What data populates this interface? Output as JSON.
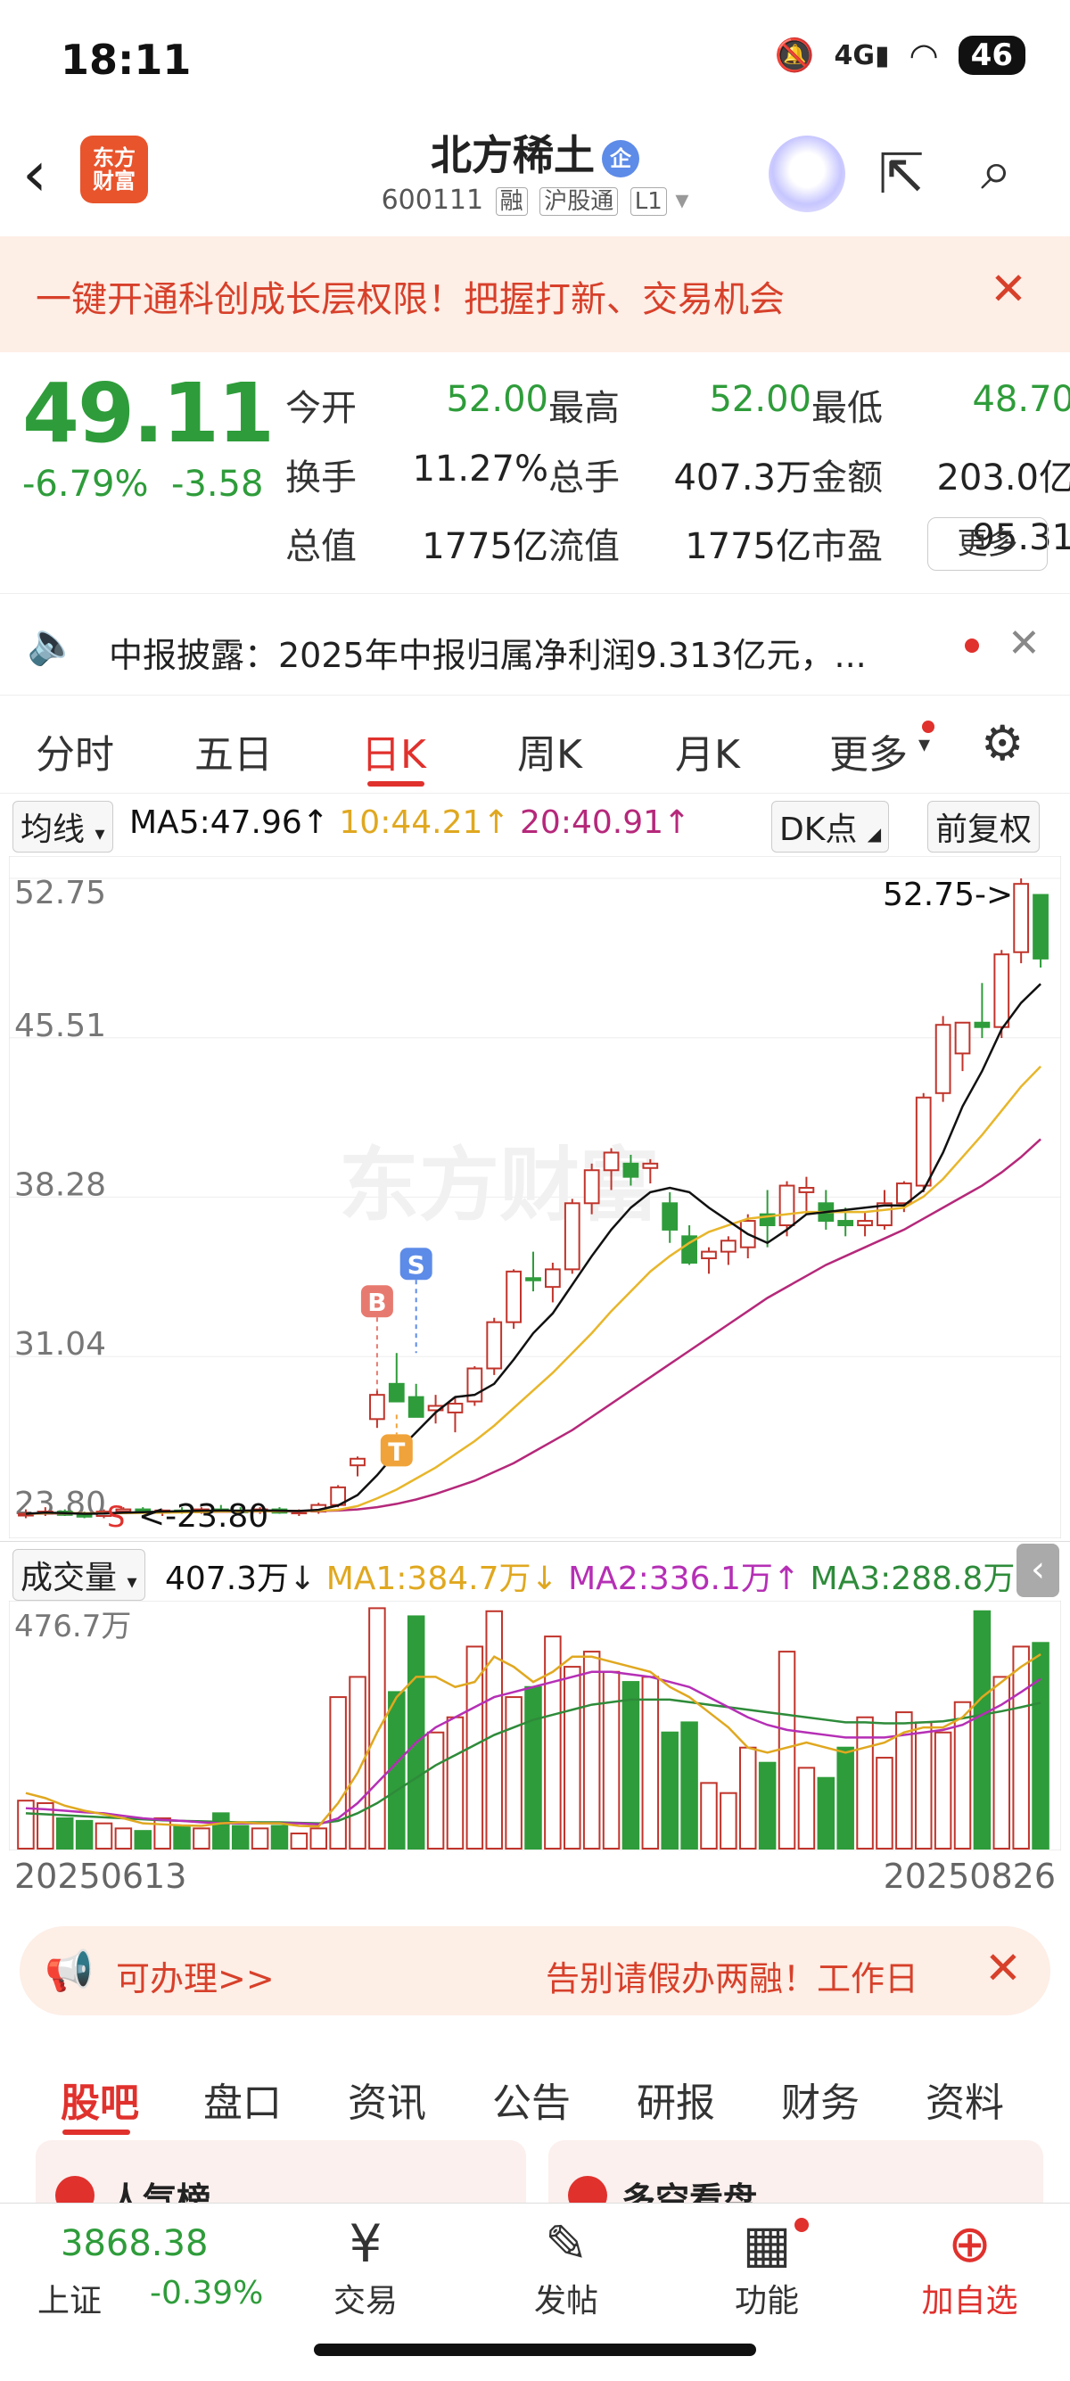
{
  "status": {
    "time": "18:11",
    "network": "4G",
    "battery": "46"
  },
  "header": {
    "logo": "东方\n财富",
    "logo_l1": "东方",
    "logo_l2": "财富",
    "name": "北方稀土",
    "name_badge": "企",
    "code": "600111",
    "tags": [
      "融",
      "沪股通",
      "L1"
    ]
  },
  "banner": {
    "text": "一键开通科创成长层权限！把握打新、交易机会"
  },
  "quote": {
    "price": "49.11",
    "pct": "-6.79%",
    "chg": "-3.58",
    "fields": [
      {
        "label": "今开",
        "value": "52.00",
        "color": "#2e9c3a"
      },
      {
        "label": "最高",
        "value": "52.00",
        "color": "#2e9c3a"
      },
      {
        "label": "最低",
        "value": "48.70",
        "color": "#2e9c3a"
      },
      {
        "label": "换手",
        "value": "11.27%",
        "color": "#222"
      },
      {
        "label": "总手",
        "value": "407.3万",
        "color": "#222"
      },
      {
        "label": "金额",
        "value": "203.0亿",
        "color": "#222"
      },
      {
        "label": "总值",
        "value": "1775亿",
        "color": "#222"
      },
      {
        "label": "流值",
        "value": "1775亿",
        "color": "#222"
      },
      {
        "label": "市盈",
        "value": "95.31",
        "color": "#222"
      }
    ],
    "more": "更多"
  },
  "notice": {
    "text": "中报披露：2025年中报归属净利润9.313亿元，..."
  },
  "tabs": [
    "分时",
    "五日",
    "日K",
    "周K",
    "月K",
    "更多"
  ],
  "chart": {
    "ma_label": "均线",
    "ma5": "MA5:47.96",
    "ma10": "10:44.21",
    "ma20": "20:40.91",
    "dk": "DK点",
    "fq": "前复权",
    "y_labels": [
      "52.75",
      "45.51",
      "38.28",
      "31.04",
      "23.80"
    ],
    "high_marker": "52.75->",
    "low_marker": "<-23.80",
    "signals": [
      "B",
      "S",
      "T",
      "S"
    ]
  },
  "volume": {
    "label": "成交量",
    "value": "407.3万",
    "ma1": "MA1:384.7万",
    "ma2": "MA2:336.1万",
    "ma3": "MA3:288.8万",
    "max": "476.7万"
  },
  "dates": {
    "start": "20250613",
    "end": "20250826"
  },
  "ad": {
    "left": "可办理>>",
    "right": "告别请假办两融！工作日"
  },
  "bottom_tabs": [
    "股吧",
    "盘口",
    "资讯",
    "公告",
    "研报",
    "财务",
    "资料"
  ],
  "cards": [
    "人气榜",
    "多空看盘"
  ],
  "index": {
    "value": "3868.38",
    "name": "上证",
    "pct": "-0.39%"
  },
  "nav": [
    "交易",
    "发帖",
    "功能",
    "加自选"
  ],
  "colors": {
    "up": "#c0342b",
    "down": "#2e9c3a",
    "ma5": "#111111",
    "ma10": "#e8b62a",
    "ma20": "#b5287a"
  },
  "chart_data": {
    "type": "candlestick",
    "candles": [
      [
        23.9,
        24.1,
        23.7,
        23.9
      ],
      [
        23.9,
        24.2,
        23.8,
        24.0
      ],
      [
        24.0,
        24.1,
        23.8,
        23.85
      ],
      [
        23.85,
        24.0,
        23.7,
        23.8
      ],
      [
        23.8,
        24.1,
        23.7,
        24.0
      ],
      [
        24.0,
        24.2,
        23.9,
        24.1
      ],
      [
        24.1,
        24.2,
        23.9,
        23.95
      ],
      [
        23.95,
        24.1,
        23.8,
        24.05
      ],
      [
        24.05,
        24.2,
        23.9,
        24.0
      ],
      [
        24.0,
        24.2,
        23.9,
        24.1
      ],
      [
        24.1,
        24.3,
        24.0,
        24.05
      ],
      [
        24.05,
        24.2,
        23.9,
        24.0
      ],
      [
        24.0,
        24.2,
        23.9,
        24.1
      ],
      [
        24.1,
        24.2,
        23.9,
        23.95
      ],
      [
        23.95,
        24.1,
        23.8,
        24.0
      ],
      [
        24.0,
        24.4,
        23.9,
        24.3
      ],
      [
        24.3,
        25.2,
        24.2,
        25.1
      ],
      [
        26.1,
        26.5,
        25.6,
        26.4
      ],
      [
        28.2,
        29.5,
        27.8,
        29.3
      ],
      [
        29.8,
        31.2,
        29.2,
        29.0
      ],
      [
        29.2,
        29.8,
        28.4,
        28.3
      ],
      [
        28.6,
        29.3,
        28.0,
        28.8
      ],
      [
        28.5,
        29.2,
        27.6,
        28.9
      ],
      [
        29.0,
        30.6,
        28.8,
        30.5
      ],
      [
        30.5,
        32.8,
        30.2,
        32.6
      ],
      [
        32.6,
        35.0,
        32.3,
        34.9
      ],
      [
        34.6,
        35.8,
        34.0,
        34.5
      ],
      [
        34.2,
        35.3,
        33.5,
        35.0
      ],
      [
        35.0,
        38.2,
        34.8,
        38.0
      ],
      [
        38.0,
        39.8,
        37.5,
        39.5
      ],
      [
        39.5,
        40.5,
        38.6,
        40.3
      ],
      [
        39.8,
        40.2,
        38.8,
        39.2
      ],
      [
        39.6,
        40.0,
        38.9,
        39.8
      ],
      [
        38.0,
        38.5,
        36.2,
        36.8
      ],
      [
        36.5,
        37.0,
        35.2,
        35.3
      ],
      [
        35.5,
        36.0,
        34.8,
        35.8
      ],
      [
        35.8,
        36.5,
        35.2,
        36.3
      ],
      [
        36.0,
        37.5,
        35.5,
        37.2
      ],
      [
        37.5,
        38.6,
        36.0,
        37.0
      ],
      [
        37.0,
        39.0,
        36.5,
        38.8
      ],
      [
        38.5,
        39.2,
        37.5,
        38.7
      ],
      [
        38.0,
        38.6,
        36.8,
        37.2
      ],
      [
        37.2,
        37.8,
        36.5,
        37.0
      ],
      [
        37.0,
        37.6,
        36.5,
        37.2
      ],
      [
        37.0,
        38.6,
        36.8,
        38.0
      ],
      [
        38.0,
        39.0,
        37.6,
        38.9
      ],
      [
        38.8,
        43.0,
        38.5,
        42.8
      ],
      [
        43.0,
        46.5,
        42.6,
        46.1
      ],
      [
        44.8,
        46.0,
        44.0,
        46.2
      ],
      [
        46.2,
        48.0,
        45.5,
        46.0
      ],
      [
        46.0,
        49.5,
        45.5,
        49.3
      ],
      [
        49.4,
        52.75,
        48.9,
        52.5
      ],
      [
        52.0,
        52.0,
        48.7,
        49.11
      ]
    ],
    "ma5": [
      23.9,
      23.95,
      23.93,
      23.9,
      23.91,
      23.95,
      23.97,
      24.0,
      24.02,
      24.04,
      24.05,
      24.04,
      24.06,
      24.04,
      24.03,
      24.08,
      24.28,
      24.75,
      25.65,
      26.7,
      27.6,
      28.5,
      29.2,
      29.3,
      29.8,
      30.9,
      32.1,
      33.0,
      34.3,
      35.6,
      36.8,
      37.8,
      38.5,
      38.7,
      38.5,
      37.8,
      37.2,
      36.6,
      36.2,
      36.8,
      37.5,
      37.6,
      37.7,
      37.8,
      37.9,
      37.9,
      38.6,
      40.3,
      42.4,
      44.0,
      45.9,
      47.1,
      47.96
    ],
    "ma10": [
      23.9,
      23.92,
      23.93,
      23.92,
      23.92,
      23.93,
      23.94,
      23.95,
      23.96,
      23.98,
      24.0,
      24.01,
      24.02,
      24.02,
      24.03,
      24.04,
      24.08,
      24.25,
      24.6,
      25.0,
      25.5,
      26.0,
      26.6,
      27.2,
      27.9,
      28.7,
      29.5,
      30.3,
      31.2,
      32.1,
      33.1,
      34.0,
      34.9,
      35.6,
      36.2,
      36.7,
      37.0,
      37.3,
      37.4,
      37.5,
      37.6,
      37.6,
      37.6,
      37.6,
      37.7,
      37.8,
      38.3,
      39.1,
      40.1,
      41.1,
      42.2,
      43.3,
      44.21
    ],
    "ma20": [
      23.9,
      23.91,
      23.92,
      23.92,
      23.93,
      23.94,
      23.95,
      23.96,
      23.97,
      23.98,
      23.99,
      24.0,
      24.01,
      24.02,
      24.02,
      24.03,
      24.05,
      24.1,
      24.2,
      24.35,
      24.55,
      24.8,
      25.1,
      25.4,
      25.8,
      26.2,
      26.7,
      27.2,
      27.7,
      28.3,
      28.9,
      29.5,
      30.1,
      30.7,
      31.3,
      31.9,
      32.5,
      33.1,
      33.7,
      34.2,
      34.7,
      35.2,
      35.6,
      36.0,
      36.4,
      36.8,
      37.3,
      37.8,
      38.3,
      38.8,
      39.4,
      40.1,
      40.91
    ],
    "volume": {
      "unit": "万",
      "max": 476.7,
      "bars": [
        95,
        90,
        60,
        55,
        50,
        40,
        35,
        60,
        45,
        40,
        70,
        45,
        40,
        45,
        30,
        40,
        300,
        340,
        476,
        310,
        460,
        230,
        260,
        400,
        470,
        300,
        320,
        420,
        360,
        390,
        350,
        330,
        340,
        230,
        250,
        130,
        110,
        200,
        170,
        390,
        160,
        140,
        200,
        260,
        180,
        270,
        250,
        230,
        290,
        470,
        340,
        400,
        407.3
      ],
      "ma1": [
        110,
        100,
        85,
        75,
        68,
        60,
        50,
        48,
        46,
        45,
        50,
        52,
        50,
        50,
        45,
        44,
        90,
        150,
        230,
        300,
        340,
        340,
        320,
        330,
        380,
        360,
        330,
        350,
        380,
        380,
        370,
        360,
        350,
        320,
        300,
        270,
        240,
        200,
        190,
        200,
        210,
        200,
        190,
        200,
        210,
        230,
        240,
        240,
        260,
        300,
        330,
        360,
        384.7
      ],
      "ma2": [
        80,
        78,
        75,
        72,
        70,
        65,
        60,
        57,
        55,
        52,
        50,
        50,
        50,
        50,
        50,
        48,
        60,
        90,
        130,
        170,
        210,
        240,
        260,
        280,
        300,
        310,
        320,
        330,
        340,
        350,
        350,
        345,
        340,
        330,
        320,
        300,
        280,
        260,
        245,
        235,
        230,
        225,
        220,
        220,
        220,
        225,
        230,
        235,
        245,
        265,
        285,
        310,
        336.1
      ],
      "ma3": [
        70,
        68,
        66,
        64,
        62,
        60,
        58,
        56,
        55,
        54,
        53,
        52,
        52,
        52,
        51,
        50,
        55,
        70,
        90,
        115,
        140,
        165,
        185,
        205,
        225,
        240,
        255,
        265,
        275,
        285,
        290,
        295,
        295,
        295,
        290,
        285,
        280,
        275,
        270,
        265,
        260,
        255,
        250,
        250,
        248,
        248,
        250,
        252,
        258,
        265,
        272,
        280,
        288.8
      ]
    }
  }
}
